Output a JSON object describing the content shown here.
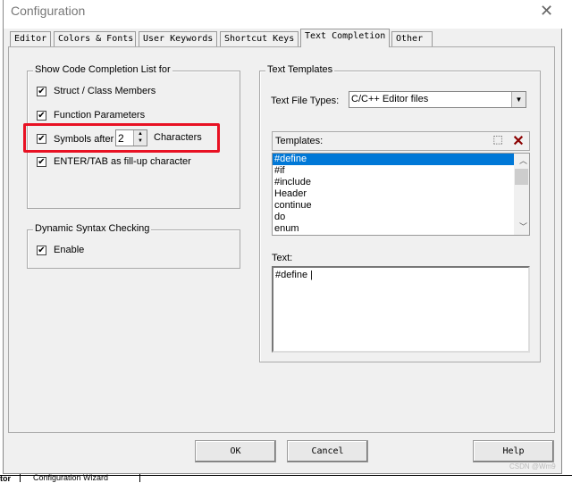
{
  "window": {
    "title": "Configuration",
    "close_icon": "close-icon"
  },
  "tabs": [
    {
      "label": "Editor"
    },
    {
      "label": "Colors & Fonts"
    },
    {
      "label": "User Keywords"
    },
    {
      "label": "Shortcut Keys"
    },
    {
      "label": "Text Completion",
      "active": true
    },
    {
      "label": "Other"
    }
  ],
  "completion": {
    "title": "Show Code Completion List for",
    "items": [
      {
        "label": "Struct / Class Members",
        "checked": true
      },
      {
        "label": "Function Parameters",
        "checked": true
      },
      {
        "label": "Symbols after",
        "checked": true
      },
      {
        "label": "ENTER/TAB as fill-up character",
        "checked": true
      }
    ],
    "symbols_count": "2",
    "characters_label": "Characters",
    "highlight_color": "#e81123"
  },
  "syntax": {
    "title": "Dynamic Syntax Checking",
    "enable_label": "Enable",
    "checked": true
  },
  "templates": {
    "title": "Text Templates",
    "file_types_label": "Text File Types:",
    "file_type_value": "C/C++ Editor files",
    "templates_label": "Templates:",
    "items": [
      "#define",
      "#if",
      "#include",
      "Header",
      "continue",
      "do",
      "enum"
    ],
    "selected": "#define",
    "text_label": "Text:",
    "text_value": "#define |"
  },
  "buttons": {
    "ok": "OK",
    "cancel": "Cancel",
    "help": "Help"
  },
  "background": {
    "tab_fragment": "tor",
    "wizard_tab": "Configuration Wizard",
    "watermark": "CSDN @Wm9"
  },
  "colors": {
    "selection": "#0078d7",
    "delete": "#8b0000"
  }
}
